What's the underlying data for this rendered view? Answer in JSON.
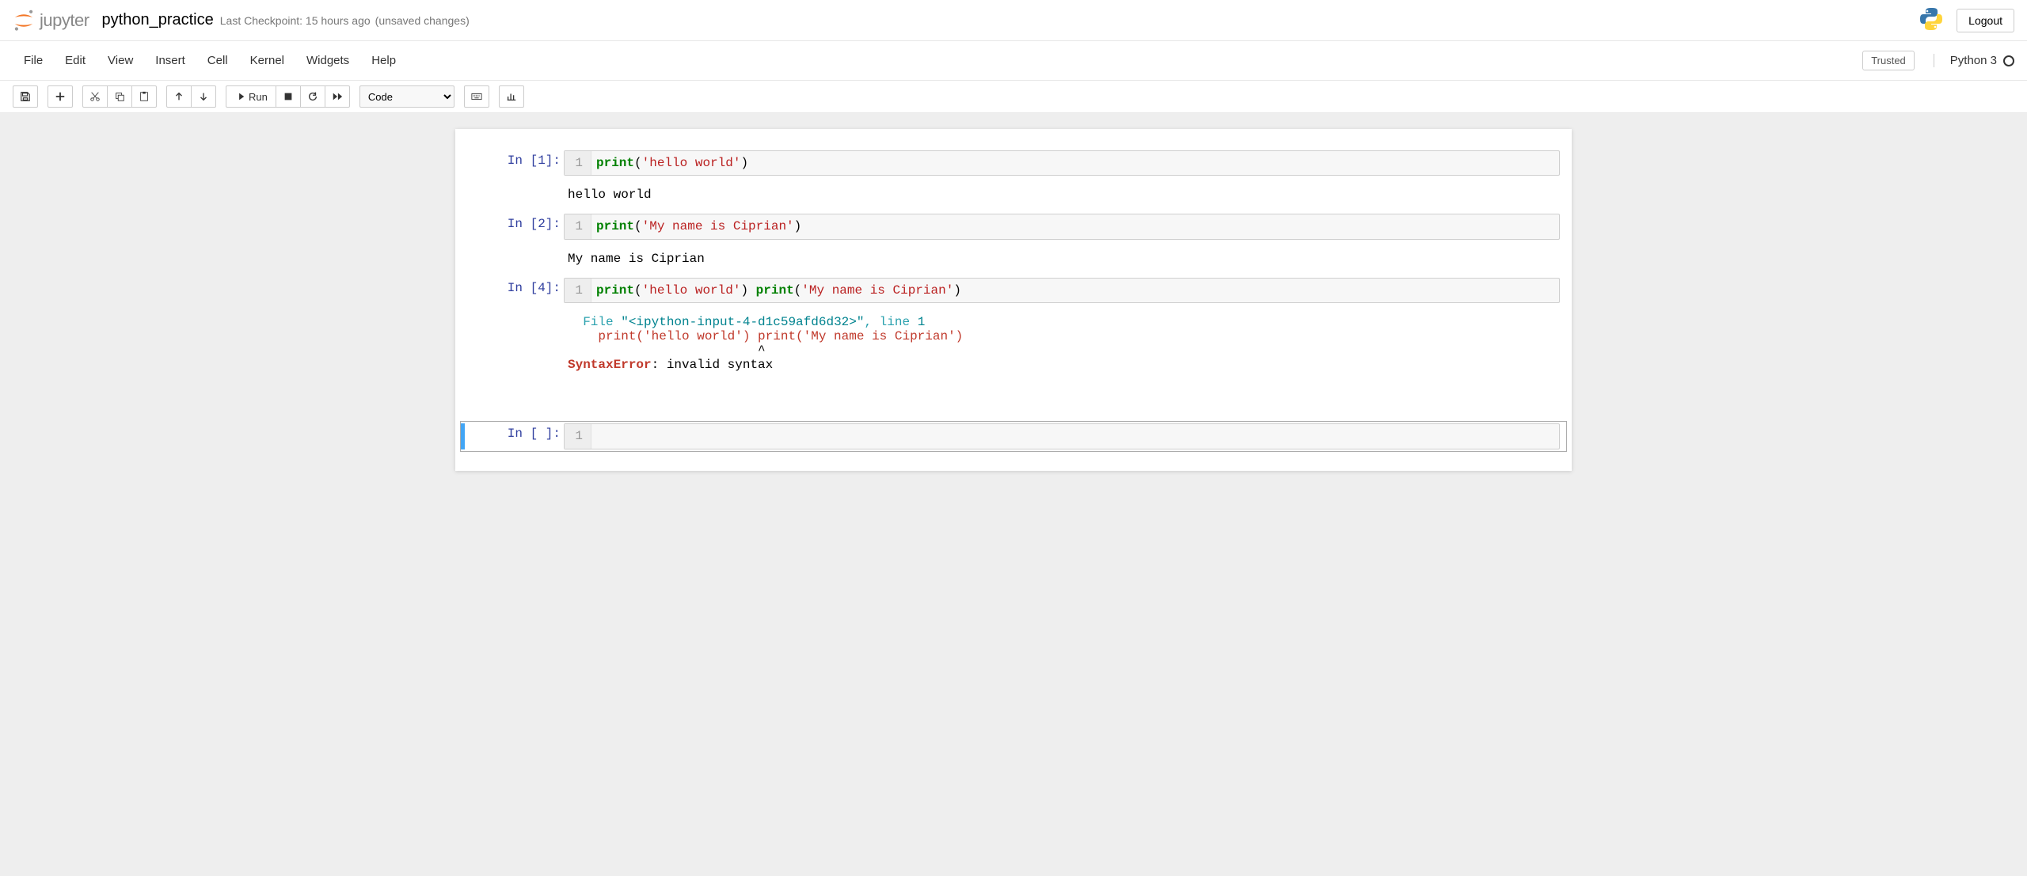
{
  "header": {
    "logo_text": "jupyter",
    "notebook_name": "python_practice",
    "checkpoint_text": "Last Checkpoint: 15 hours ago",
    "unsaved_text": "(unsaved changes)",
    "logout_label": "Logout"
  },
  "menubar": {
    "items": [
      "File",
      "Edit",
      "View",
      "Insert",
      "Cell",
      "Kernel",
      "Widgets",
      "Help"
    ],
    "trusted_label": "Trusted",
    "kernel_label": "Python 3"
  },
  "toolbar": {
    "run_label": "Run",
    "cell_type": "Code"
  },
  "cells": [
    {
      "exec_count": "1",
      "line_no": "1",
      "code_tokens": {
        "builtin": "print",
        "open": "(",
        "str": "'hello world'",
        "close": ")"
      },
      "output_text": "hello world"
    },
    {
      "exec_count": "2",
      "line_no": "1",
      "code_tokens": {
        "builtin": "print",
        "open": "(",
        "str": "'My name is Ciprian'",
        "close": ")"
      },
      "output_text": "My name is Ciprian"
    },
    {
      "exec_count": "4",
      "line_no": "1",
      "code_tokens": {
        "b1": "print",
        "o1": "(",
        "s1": "'hello world'",
        "c1": ") ",
        "b2": "print",
        "o2": "(",
        "s2": "'My name is Ciprian'",
        "c2": ")"
      },
      "error": {
        "file_prefix": "  File ",
        "file_name": "\"<ipython-input-4-d1c59afd6d32>\"",
        "line_sep": ", line ",
        "line_no": "1",
        "echo": "    print('hello world') print('My name is Ciprian')",
        "caret": "                         ^",
        "err_name": "SyntaxError",
        "err_colon": ": ",
        "err_msg": "invalid syntax"
      }
    },
    {
      "exec_count": " ",
      "line_no": "1",
      "empty": true
    }
  ]
}
